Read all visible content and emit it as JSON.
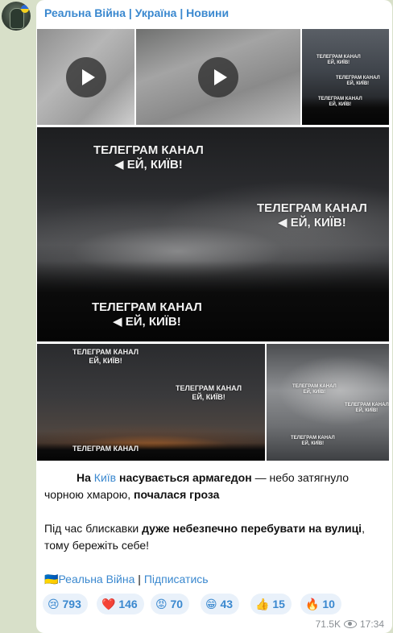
{
  "channel": {
    "title": "Реальна Війна | Україна | Новини"
  },
  "watermark": {
    "line1": "ТЕЛЕГРАМ КАНАЛ",
    "line2": "ЕЙ, КИЇВ!"
  },
  "caption": {
    "p1": {
      "t1": "На ",
      "link": "Київ",
      "t2": "насувається армагедон",
      "t3": " — небо затягнуло чорною хмарою, ",
      "t4": "почалася гроза"
    },
    "p2": {
      "t1": "Під час блискавки ",
      "t2": "дуже небезпечно перебувати на вулиці",
      "t3": ", тому бережіть себе!"
    },
    "footer": {
      "flag_emoji": "🇺🇦",
      "channel_link": "Реальна Війна",
      "separator": " | ",
      "subscribe_link": "Підписатись"
    }
  },
  "reactions": [
    {
      "emoji": "😢",
      "count": "793"
    },
    {
      "emoji": "❤️",
      "count": "146"
    },
    {
      "emoji": "😡",
      "count": "70"
    },
    {
      "emoji": "😁",
      "count": "43"
    },
    {
      "emoji": "👍",
      "count": "15"
    },
    {
      "emoji": "🔥",
      "count": "10"
    }
  ],
  "meta": {
    "views": "71.5K",
    "time": "17:34"
  }
}
